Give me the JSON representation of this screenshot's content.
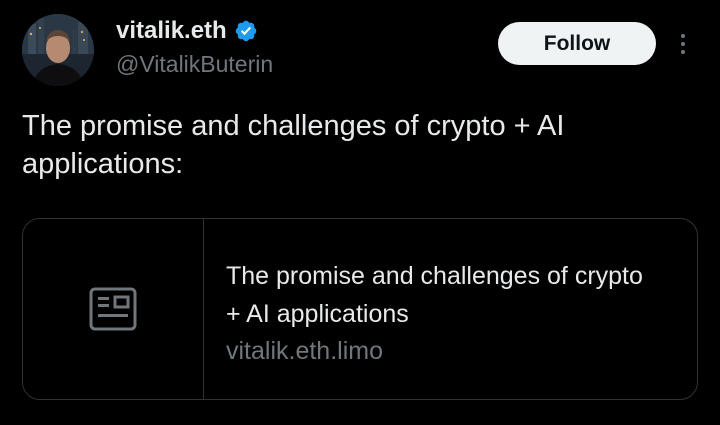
{
  "author": {
    "display_name": "vitalik.eth",
    "handle": "@VitalikButerin",
    "verified": true,
    "verified_icon": "verified-badge-icon",
    "verified_color": "#1d9bf0"
  },
  "actions": {
    "follow_label": "Follow",
    "more_icon": "more-vertical-icon"
  },
  "tweet": {
    "text": "The promise and challenges of crypto + AI applications:"
  },
  "link_card": {
    "thumbnail_icon": "article-icon",
    "title": "The promise and challenges of crypto + AI applications",
    "domain": "vitalik.eth.limo"
  },
  "colors": {
    "background": "#000000",
    "primary_text": "#e7e9ea",
    "secondary_text": "#71767b",
    "border": "#2f3336",
    "button_bg": "#eff3f4",
    "button_text": "#0f1419"
  }
}
